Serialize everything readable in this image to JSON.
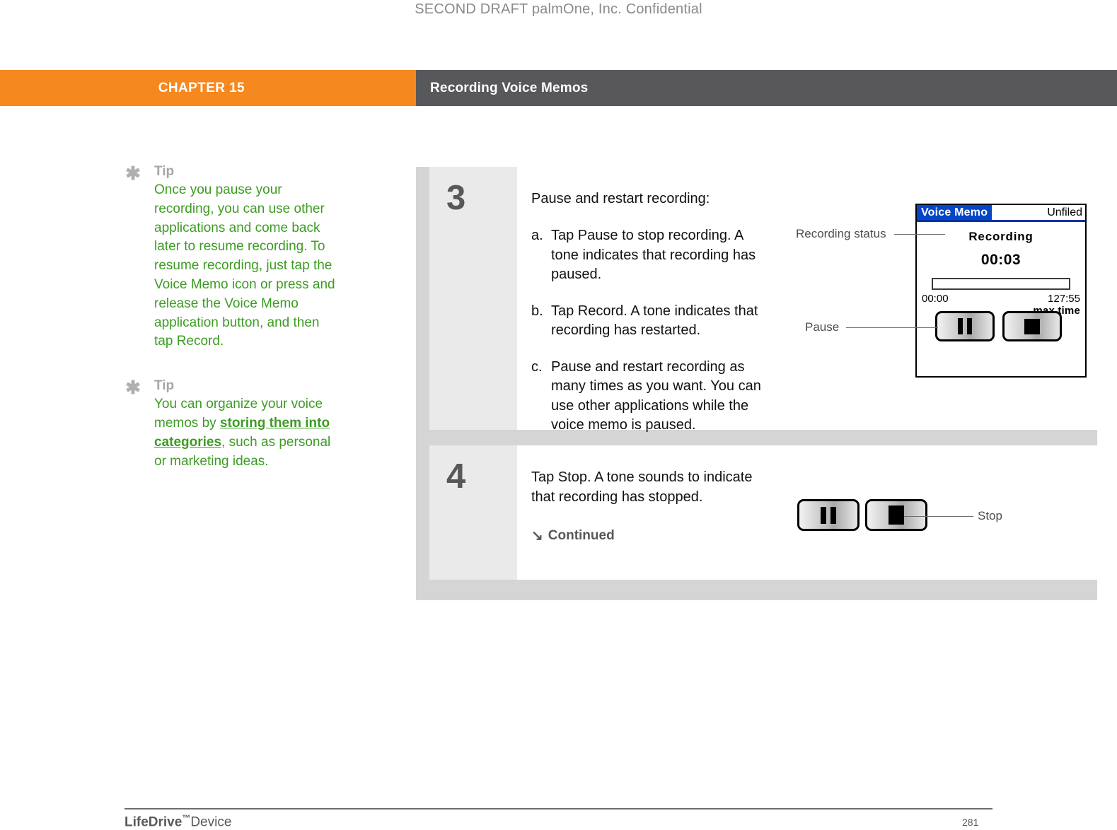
{
  "draft_notice": "SECOND DRAFT palmOne, Inc.  Confidential",
  "header": {
    "chapter_label": "CHAPTER 15",
    "chapter_title": "Recording Voice Memos",
    "orange_hex": "#f5881f",
    "gray_hex": "#58585a"
  },
  "tips": [
    {
      "icon": "asterisk-icon",
      "title": "Tip",
      "body_part1": "Once you pause your recording, you can use other applications and come back later to resume recording. To resume recording, just tap the Voice Memo icon or press and release the Voice Memo application button, and then tap Record.",
      "link_text": "",
      "body_part2": ""
    },
    {
      "icon": "asterisk-icon",
      "title": "Tip",
      "body_part1": "You can organize your voice memos by ",
      "link_text": "storing them into categories",
      "body_part2": ", such as personal or marketing ideas."
    }
  ],
  "tip_text_color": "#3c9c22",
  "steps": [
    {
      "number": "3",
      "intro": "Pause and restart recording:",
      "substeps": [
        {
          "marker": "a.",
          "text": "Tap Pause to stop recording. A tone indicates that recording has paused."
        },
        {
          "marker": "b.",
          "text": "Tap Record. A tone indicates that recording has restarted."
        },
        {
          "marker": "c.",
          "text": "Pause and restart recording as many times as you want. You can use other applications while the voice memo is paused."
        }
      ]
    },
    {
      "number": "4",
      "text": "Tap Stop. A tone sounds to indicate that recording has stopped.",
      "continued_arrow": "↘",
      "continued_label": "Continued"
    }
  ],
  "pda_screen": {
    "app_tab": "Voice Memo",
    "category": "Unfiled",
    "status": "Recording",
    "elapsed": "00:03",
    "bar_start": "00:00",
    "bar_end": "127:55",
    "bar_end_caption": "max time",
    "buttons": [
      {
        "name": "pause-button",
        "glyph": "pause"
      },
      {
        "name": "stop-button",
        "glyph": "stop"
      }
    ],
    "title_blue_hex": "#0645c8"
  },
  "callouts": {
    "recording_status": "Recording status",
    "pause": "Pause",
    "stop": "Stop"
  },
  "footer": {
    "brand": "LifeDrive",
    "tm": "™",
    "product": "Device",
    "page_number": "281"
  }
}
